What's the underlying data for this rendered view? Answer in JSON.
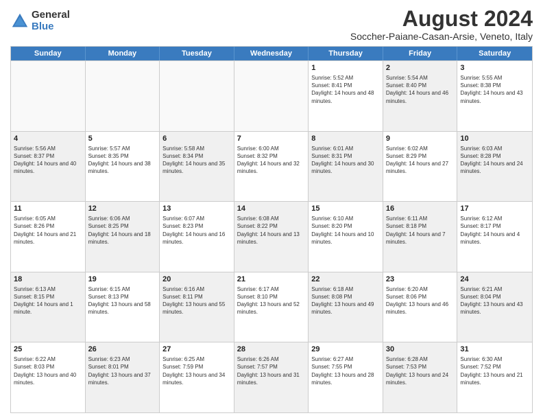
{
  "logo": {
    "general": "General",
    "blue": "Blue"
  },
  "title": "August 2024",
  "subtitle": "Soccher-Paiane-Casan-Arsie, Veneto, Italy",
  "days": [
    "Sunday",
    "Monday",
    "Tuesday",
    "Wednesday",
    "Thursday",
    "Friday",
    "Saturday"
  ],
  "rows": [
    [
      {
        "day": "",
        "text": "",
        "empty": true
      },
      {
        "day": "",
        "text": "",
        "empty": true
      },
      {
        "day": "",
        "text": "",
        "empty": true
      },
      {
        "day": "",
        "text": "",
        "empty": true
      },
      {
        "day": "1",
        "text": "Sunrise: 5:52 AM\nSunset: 8:41 PM\nDaylight: 14 hours and 48 minutes."
      },
      {
        "day": "2",
        "text": "Sunrise: 5:54 AM\nSunset: 8:40 PM\nDaylight: 14 hours and 46 minutes.",
        "shaded": true
      },
      {
        "day": "3",
        "text": "Sunrise: 5:55 AM\nSunset: 8:38 PM\nDaylight: 14 hours and 43 minutes."
      }
    ],
    [
      {
        "day": "4",
        "text": "Sunrise: 5:56 AM\nSunset: 8:37 PM\nDaylight: 14 hours and 40 minutes.",
        "shaded": true
      },
      {
        "day": "5",
        "text": "Sunrise: 5:57 AM\nSunset: 8:35 PM\nDaylight: 14 hours and 38 minutes."
      },
      {
        "day": "6",
        "text": "Sunrise: 5:58 AM\nSunset: 8:34 PM\nDaylight: 14 hours and 35 minutes.",
        "shaded": true
      },
      {
        "day": "7",
        "text": "Sunrise: 6:00 AM\nSunset: 8:32 PM\nDaylight: 14 hours and 32 minutes."
      },
      {
        "day": "8",
        "text": "Sunrise: 6:01 AM\nSunset: 8:31 PM\nDaylight: 14 hours and 30 minutes.",
        "shaded": true
      },
      {
        "day": "9",
        "text": "Sunrise: 6:02 AM\nSunset: 8:29 PM\nDaylight: 14 hours and 27 minutes."
      },
      {
        "day": "10",
        "text": "Sunrise: 6:03 AM\nSunset: 8:28 PM\nDaylight: 14 hours and 24 minutes.",
        "shaded": true
      }
    ],
    [
      {
        "day": "11",
        "text": "Sunrise: 6:05 AM\nSunset: 8:26 PM\nDaylight: 14 hours and 21 minutes."
      },
      {
        "day": "12",
        "text": "Sunrise: 6:06 AM\nSunset: 8:25 PM\nDaylight: 14 hours and 18 minutes.",
        "shaded": true
      },
      {
        "day": "13",
        "text": "Sunrise: 6:07 AM\nSunset: 8:23 PM\nDaylight: 14 hours and 16 minutes."
      },
      {
        "day": "14",
        "text": "Sunrise: 6:08 AM\nSunset: 8:22 PM\nDaylight: 14 hours and 13 minutes.",
        "shaded": true
      },
      {
        "day": "15",
        "text": "Sunrise: 6:10 AM\nSunset: 8:20 PM\nDaylight: 14 hours and 10 minutes."
      },
      {
        "day": "16",
        "text": "Sunrise: 6:11 AM\nSunset: 8:18 PM\nDaylight: 14 hours and 7 minutes.",
        "shaded": true
      },
      {
        "day": "17",
        "text": "Sunrise: 6:12 AM\nSunset: 8:17 PM\nDaylight: 14 hours and 4 minutes."
      }
    ],
    [
      {
        "day": "18",
        "text": "Sunrise: 6:13 AM\nSunset: 8:15 PM\nDaylight: 14 hours and 1 minute.",
        "shaded": true
      },
      {
        "day": "19",
        "text": "Sunrise: 6:15 AM\nSunset: 8:13 PM\nDaylight: 13 hours and 58 minutes."
      },
      {
        "day": "20",
        "text": "Sunrise: 6:16 AM\nSunset: 8:11 PM\nDaylight: 13 hours and 55 minutes.",
        "shaded": true
      },
      {
        "day": "21",
        "text": "Sunrise: 6:17 AM\nSunset: 8:10 PM\nDaylight: 13 hours and 52 minutes."
      },
      {
        "day": "22",
        "text": "Sunrise: 6:18 AM\nSunset: 8:08 PM\nDaylight: 13 hours and 49 minutes.",
        "shaded": true
      },
      {
        "day": "23",
        "text": "Sunrise: 6:20 AM\nSunset: 8:06 PM\nDaylight: 13 hours and 46 minutes."
      },
      {
        "day": "24",
        "text": "Sunrise: 6:21 AM\nSunset: 8:04 PM\nDaylight: 13 hours and 43 minutes.",
        "shaded": true
      }
    ],
    [
      {
        "day": "25",
        "text": "Sunrise: 6:22 AM\nSunset: 8:03 PM\nDaylight: 13 hours and 40 minutes."
      },
      {
        "day": "26",
        "text": "Sunrise: 6:23 AM\nSunset: 8:01 PM\nDaylight: 13 hours and 37 minutes.",
        "shaded": true
      },
      {
        "day": "27",
        "text": "Sunrise: 6:25 AM\nSunset: 7:59 PM\nDaylight: 13 hours and 34 minutes."
      },
      {
        "day": "28",
        "text": "Sunrise: 6:26 AM\nSunset: 7:57 PM\nDaylight: 13 hours and 31 minutes.",
        "shaded": true
      },
      {
        "day": "29",
        "text": "Sunrise: 6:27 AM\nSunset: 7:55 PM\nDaylight: 13 hours and 28 minutes."
      },
      {
        "day": "30",
        "text": "Sunrise: 6:28 AM\nSunset: 7:53 PM\nDaylight: 13 hours and 24 minutes.",
        "shaded": true
      },
      {
        "day": "31",
        "text": "Sunrise: 6:30 AM\nSunset: 7:52 PM\nDaylight: 13 hours and 21 minutes."
      }
    ]
  ]
}
